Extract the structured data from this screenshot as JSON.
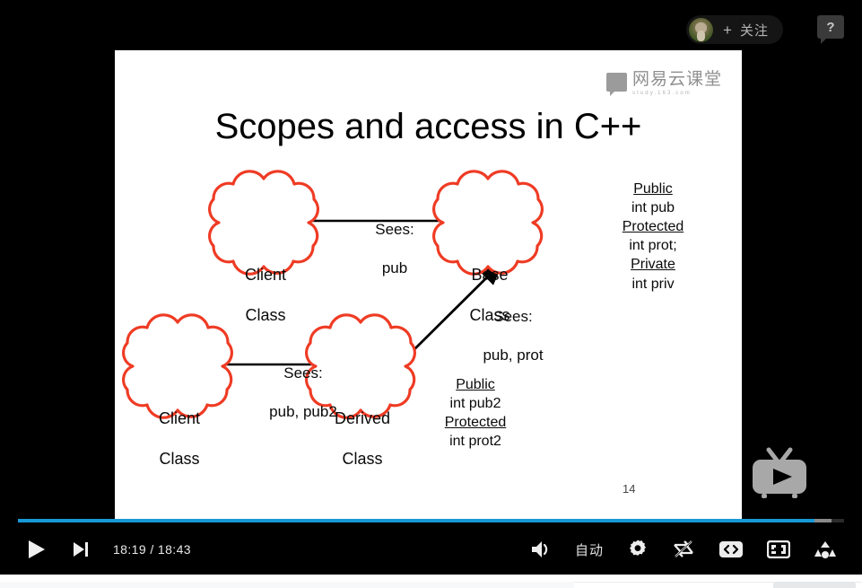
{
  "player": {
    "follow_button": {
      "plus": "+",
      "label": "关注",
      "avatar_alt": "cat-avatar"
    },
    "help_button": {
      "glyph": "?"
    },
    "time_display": "18:19 / 18:43",
    "current_time": "18:19",
    "duration": "18:43",
    "progress_percent": 96.4,
    "buffer_percent": 98.5,
    "accent_color": "#1799d6",
    "quality_label": "自动",
    "controls": {
      "play": "play-button",
      "next": "next-button",
      "volume": "volume-button",
      "settings": "settings-button",
      "loop_off": "loop-off-button",
      "embed": "embed-code-button",
      "fullscreen": "fullscreen-button",
      "danmaku": "danmaku-button"
    },
    "pip_badge": "tv-play-badge"
  },
  "slide": {
    "logo": {
      "main": "网易云课堂",
      "sub": "study.163.com"
    },
    "title": "Scopes and access in C++",
    "page_number": "14",
    "cloud_outline_color": "#ef3b24",
    "nodes": [
      {
        "id": "client-class-top",
        "line1": "Client",
        "line2": "Class"
      },
      {
        "id": "base-class",
        "line1": "Base",
        "line2": "Class"
      },
      {
        "id": "client-class-bottom",
        "line1": "Client",
        "line2": "Class"
      },
      {
        "id": "derived-class",
        "line1": "Derived",
        "line2": "Class"
      }
    ],
    "edges": [
      {
        "id": "client-to-base",
        "line1": "Sees:",
        "line2": "pub"
      },
      {
        "id": "derived-to-base",
        "line1": "Sees:",
        "line2": "pub, prot"
      },
      {
        "id": "client-to-derived",
        "line1": "Sees:",
        "line2": "pub, pub2"
      }
    ],
    "base_members": {
      "public_hdr": "Public",
      "public_member": "int pub",
      "protected_hdr": "Protected",
      "protected_member": "int prot;",
      "private_hdr": "Private",
      "private_member": "int priv"
    },
    "derived_members": {
      "public_hdr": "Public",
      "public_member": "int pub2",
      "protected_hdr": "Protected",
      "protected_member": "int prot2"
    }
  }
}
